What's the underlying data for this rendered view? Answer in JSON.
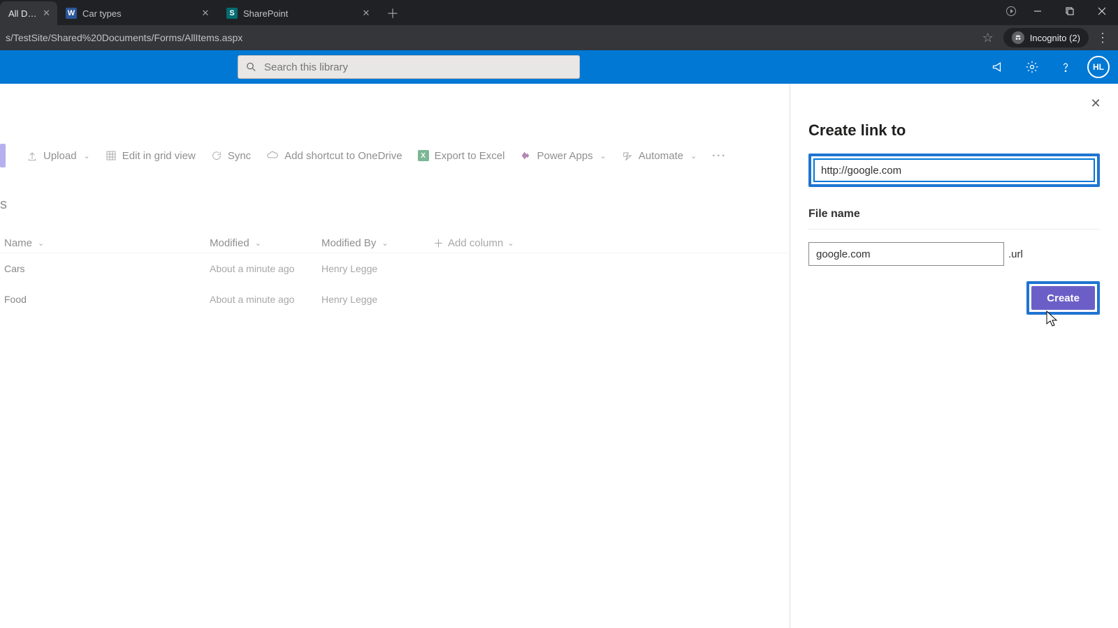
{
  "browser": {
    "tabs": [
      {
        "title": "All Docum",
        "active": true
      },
      {
        "title": "Car types",
        "favicon": "W"
      },
      {
        "title": "SharePoint",
        "favicon": "S"
      }
    ],
    "url": "s/TestSite/Shared%20Documents/Forms/AllItems.aspx",
    "incognito_label": "Incognito (2)"
  },
  "suite": {
    "search_placeholder": "Search this library",
    "avatar_initials": "HL"
  },
  "commandbar": {
    "upload": "Upload",
    "edit_grid": "Edit in grid view",
    "sync": "Sync",
    "onedrive": "Add shortcut to OneDrive",
    "excel": "Export to Excel",
    "powerapps": "Power Apps",
    "automate": "Automate"
  },
  "library": {
    "heading_fragment": "s",
    "columns": {
      "name": "Name",
      "modified": "Modified",
      "modified_by": "Modified By",
      "add": "Add column"
    },
    "rows": [
      {
        "name": "Cars",
        "modified": "About a minute ago",
        "by": "Henry Legge"
      },
      {
        "name": "Food",
        "modified": "About a minute ago",
        "by": "Henry Legge"
      }
    ]
  },
  "panel": {
    "title": "Create link to",
    "url_value": "http://google.com",
    "file_label": "File name",
    "file_value": "google.com",
    "file_ext": ".url",
    "create": "Create"
  }
}
